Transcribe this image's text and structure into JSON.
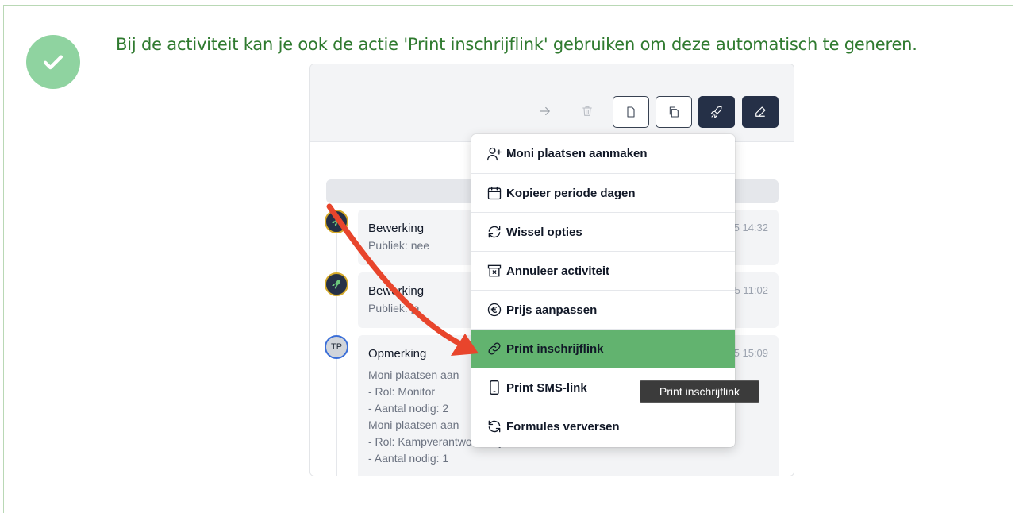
{
  "callout": {
    "text": "Bij de activiteit kan je ook de actie 'Print inschrijflink' gebruiken om deze automatisch te generen."
  },
  "toolbar": {
    "icons": [
      "arrow-right-icon",
      "trash-icon",
      "file-icon",
      "copy-icon",
      "rocket-icon",
      "eraser-icon"
    ]
  },
  "timeline": {
    "items": [
      {
        "title": "Bewerking",
        "lines": [
          "Publiek: nee"
        ],
        "time": "5 14:32",
        "avatar": "rocket"
      },
      {
        "title": "Bewerking",
        "lines": [
          "Publiek: ja"
        ],
        "time": "5 11:02",
        "avatar": "rocket"
      },
      {
        "title": "Opmerking",
        "lines": [
          "Moni plaatsen aan",
          "- Rol: Monitor",
          "- Aantal nodig: 2",
          "Moni plaatsen aan",
          "- Rol: Kampverantwoordelijke",
          "- Aantal nodig: 1"
        ],
        "time": "5 15:09",
        "avatar": "TP"
      }
    ]
  },
  "menu": {
    "items": [
      {
        "label": "Moni plaatsen aanmaken",
        "icon": "user-plus-icon"
      },
      {
        "label": "Kopieer periode dagen",
        "icon": "calendar-icon"
      },
      {
        "label": "Wissel opties",
        "icon": "swap-icon"
      },
      {
        "label": "Annuleer activiteit",
        "icon": "archive-x-icon"
      },
      {
        "label": "Prijs aanpassen",
        "icon": "euro-icon"
      },
      {
        "label": "Print inschrijflink",
        "icon": "link-icon",
        "active": true
      },
      {
        "label": "Print SMS-link",
        "icon": "phone-icon"
      },
      {
        "label": "Formules verversen",
        "icon": "refresh-icon"
      }
    ]
  },
  "tooltip": {
    "text": "Print inschrijflink"
  },
  "colors": {
    "accent_green": "#62b36f",
    "callout_text": "#2f7a2f",
    "dark_button": "#253047",
    "arrow": "#e8452c"
  }
}
